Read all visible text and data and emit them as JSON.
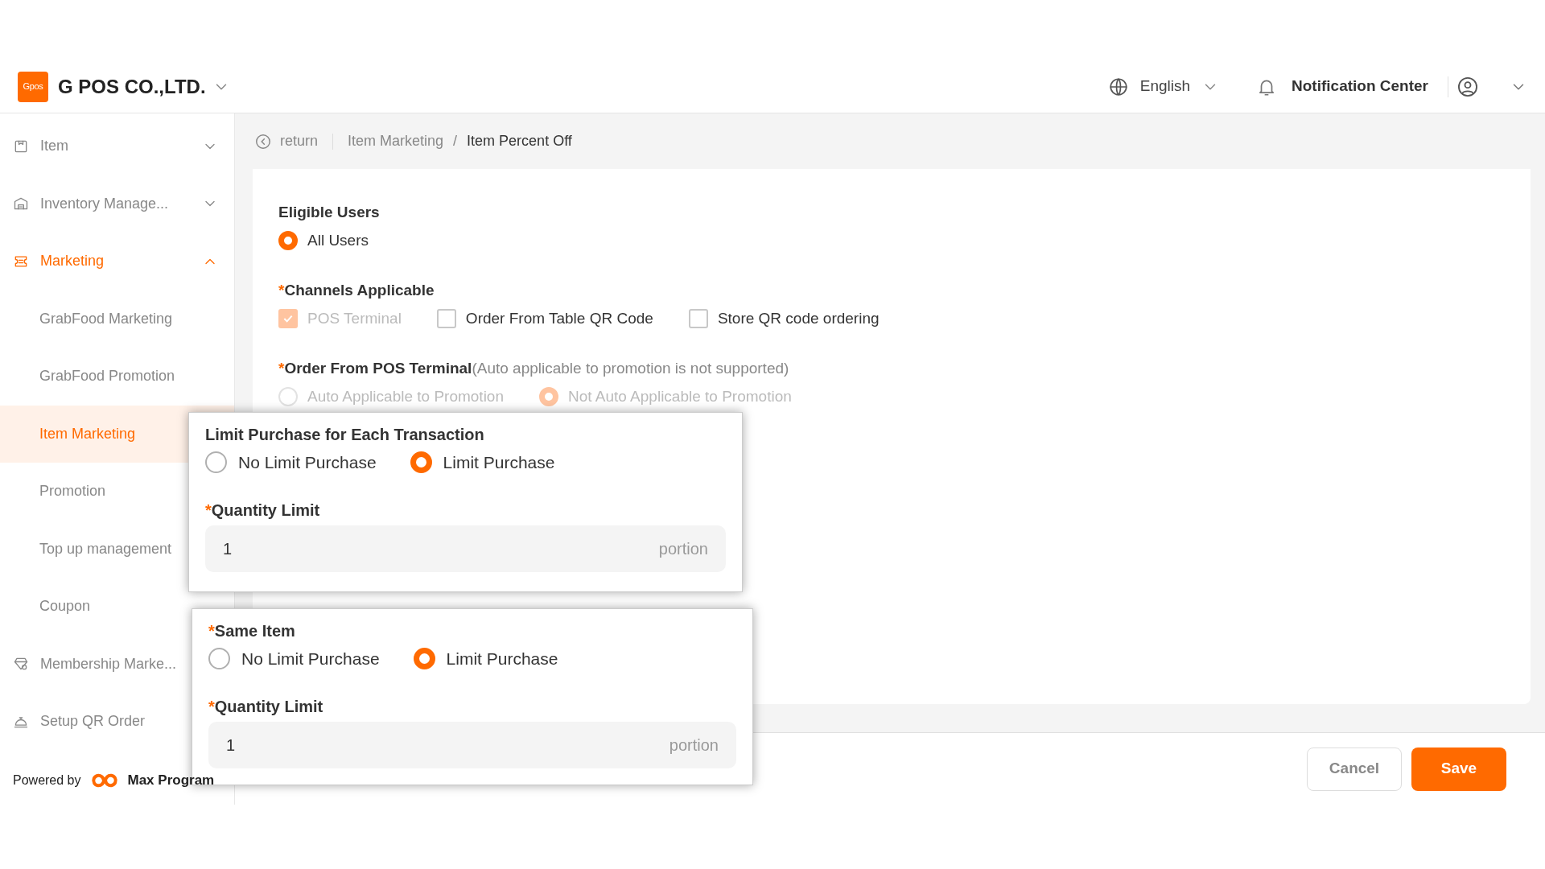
{
  "header": {
    "logo_text": "Gpos",
    "company": "G POS CO.,LTD.",
    "language": "English",
    "notifications": "Notification Center"
  },
  "sidebar": {
    "items": [
      {
        "kind": "item",
        "label": "Item",
        "expanded": false,
        "selected": false
      },
      {
        "kind": "inventory",
        "label": "Inventory Manage...",
        "expanded": false,
        "selected": false
      },
      {
        "kind": "marketing",
        "label": "Marketing",
        "expanded": true,
        "selected": true,
        "children": [
          {
            "label": "GrabFood Marketing",
            "selected": false
          },
          {
            "label": "GrabFood Promotion",
            "selected": false
          },
          {
            "label": "Item Marketing",
            "selected": true
          },
          {
            "label": "Promotion",
            "selected": false
          },
          {
            "label": "Top up management",
            "selected": false
          },
          {
            "label": "Coupon",
            "selected": false
          }
        ]
      },
      {
        "kind": "membership",
        "label": "Membership Marke...",
        "selected": false
      },
      {
        "kind": "qr",
        "label": "Setup QR Order",
        "selected": false
      }
    ],
    "powered_by": {
      "label": "Powered by",
      "brand": "Max Program"
    }
  },
  "breadcrumb": {
    "back": "return",
    "separator": "/",
    "items": [
      "Item Marketing",
      "Item Percent Off"
    ]
  },
  "form": {
    "eligible_users": {
      "label": "Eligible Users",
      "options": [
        {
          "label": "All Users",
          "selected": true,
          "disabled": false
        }
      ]
    },
    "channels": {
      "label": "Channels Applicable",
      "marker": "*",
      "options": [
        {
          "label": "POS Terminal",
          "checked": true,
          "disabled": true
        },
        {
          "label": "Order From Table QR Code",
          "checked": false,
          "disabled": false
        },
        {
          "label": "Store QR code ordering",
          "checked": false,
          "disabled": false
        }
      ]
    },
    "pos_order": {
      "label": "Order From POS Terminal",
      "note": "(Auto applicable to promotion is not supported)",
      "marker": "*",
      "options": [
        {
          "label": "Auto Applicable to Promotion",
          "selected": false,
          "disabled": true
        },
        {
          "label": "Not Auto Applicable to Promotion",
          "selected": true,
          "disabled": true
        }
      ]
    }
  },
  "callouts": [
    {
      "label": "Limit Purchase for Each Transaction",
      "options": [
        {
          "label": "No Limit Purchase",
          "selected": false
        },
        {
          "label": "Limit Purchase",
          "selected": true
        }
      ],
      "quantity": {
        "label": "Quantity Limit",
        "marker": "*",
        "value": "1",
        "unit": "portion"
      }
    },
    {
      "label": "Same Item",
      "marker": "*",
      "options": [
        {
          "label": "No Limit Purchase",
          "selected": false
        },
        {
          "label": "Limit Purchase",
          "selected": true
        }
      ],
      "quantity": {
        "label": "Quantity Limit",
        "marker": "*",
        "value": "1",
        "unit": "portion"
      }
    }
  ],
  "footer": {
    "buttons": [
      {
        "kind": "secondary",
        "label": "Cancel"
      },
      {
        "kind": "primary",
        "label": "Save"
      }
    ]
  }
}
